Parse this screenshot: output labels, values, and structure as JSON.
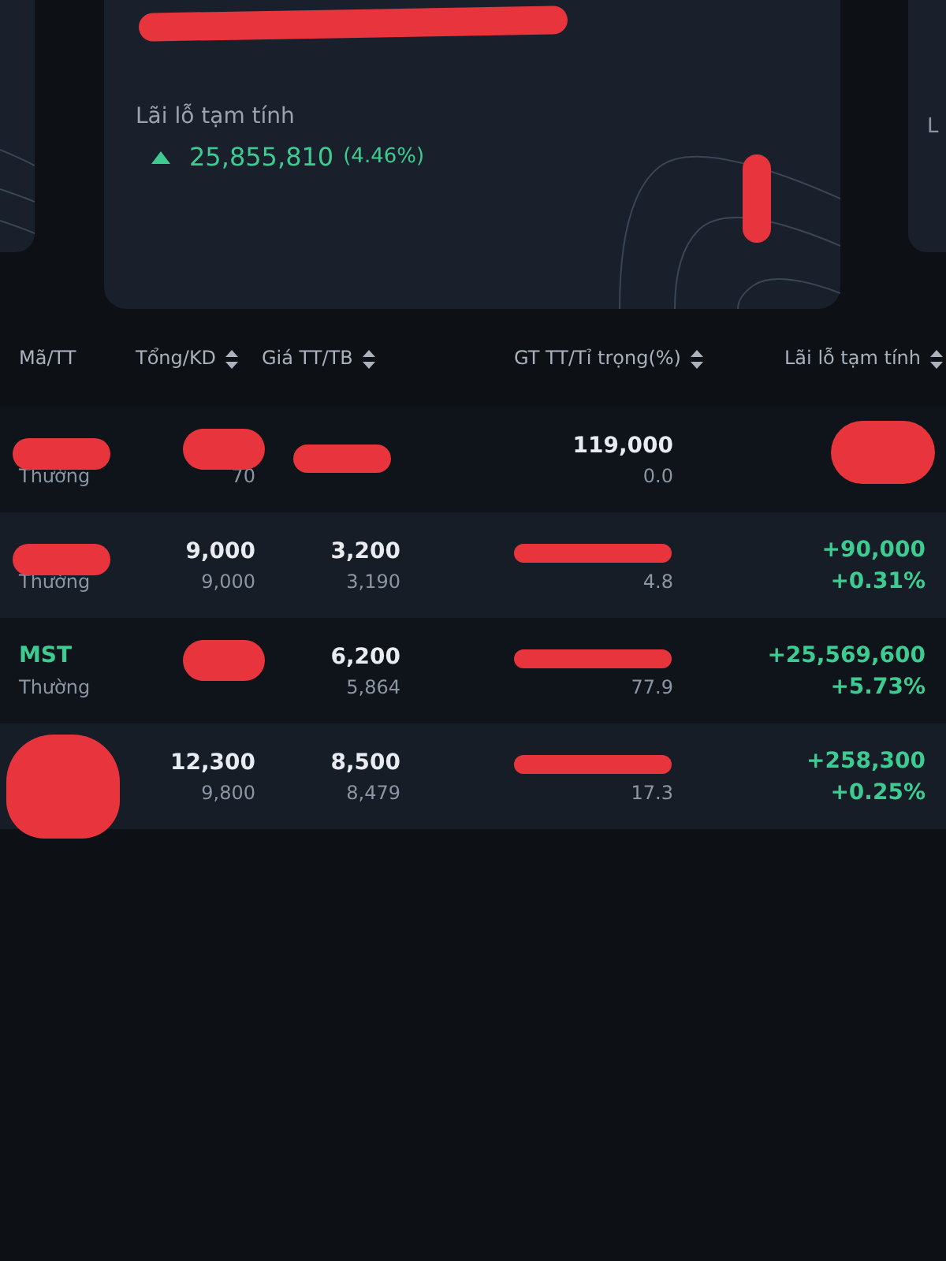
{
  "side_card_right": {
    "text": "L"
  },
  "summary_card": {
    "value_hidden": true,
    "corner_mark": true,
    "label": "Lãi lỗ tạm tính",
    "positive": true,
    "pnl": "25,855,810",
    "pnl_pct": "(4.46%)"
  },
  "table": {
    "columns": [
      {
        "label": "Mã/TT",
        "sortable": false
      },
      {
        "label": "Tổng/KD",
        "sortable": true
      },
      {
        "label": "Giá TT/TB",
        "sortable": true
      },
      {
        "label": "GT TT/Tỉ trọng(%)",
        "sortable": true
      },
      {
        "label": "Lãi lỗ tạm tính",
        "sortable": true
      }
    ],
    "rows": [
      {
        "type": "Thường",
        "available": "70",
        "value": "119,000",
        "weight": "0.0",
        "code_hidden": true,
        "total_hidden": true,
        "price_hidden": true,
        "pnl_hidden": true
      },
      {
        "type": "Thường",
        "total": "9,000",
        "available": "9,000",
        "price": "3,200",
        "average": "3,190",
        "weight": "4.8",
        "pnl": "+90,000",
        "pnl_pct": "+0.31%",
        "positive": true,
        "code_hidden": true,
        "value_hidden": true
      },
      {
        "code": "MST",
        "type": "Thường",
        "price": "6,200",
        "average": "5,864",
        "weight": "77.9",
        "pnl": "+25,569,600",
        "pnl_pct": "+5.73%",
        "positive": true,
        "total_hidden": true,
        "value_hidden": true
      },
      {
        "total": "12,300",
        "available": "9,800",
        "price": "8,500",
        "average": "8,479",
        "weight": "17.3",
        "pnl": "+258,300",
        "pnl_pct": "+0.25%",
        "positive": true,
        "code_hidden": true,
        "value_hidden": true
      }
    ]
  }
}
